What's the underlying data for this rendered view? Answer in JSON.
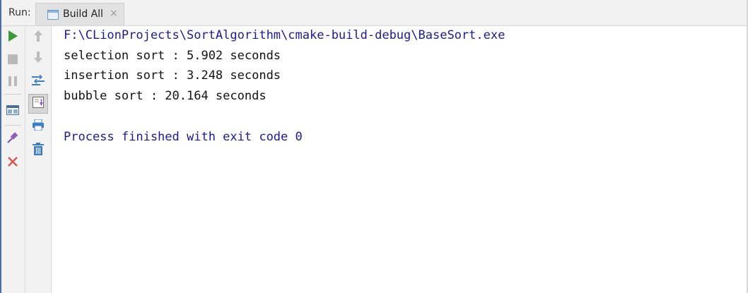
{
  "run_panel": {
    "run_label": "Run:",
    "tab": {
      "label": "Build All",
      "close": "×"
    }
  },
  "toolbar_left": [
    {
      "name": "rerun-button",
      "icon": "play-icon"
    },
    {
      "name": "stop-button",
      "icon": "stop-icon"
    },
    {
      "name": "pause-button",
      "icon": "pause-icon"
    },
    {
      "name": "layout-button",
      "icon": "layout-icon"
    },
    {
      "name": "pin-button",
      "icon": "pin-icon"
    },
    {
      "name": "close-button",
      "icon": "close-icon"
    }
  ],
  "toolbar_right": [
    {
      "name": "up-button",
      "icon": "arrow-up-icon"
    },
    {
      "name": "down-button",
      "icon": "arrow-down-icon"
    },
    {
      "name": "soft-wrap-button",
      "icon": "soft-wrap-icon"
    },
    {
      "name": "scroll-to-end-button",
      "icon": "scroll-to-end-icon"
    },
    {
      "name": "print-button",
      "icon": "print-icon"
    },
    {
      "name": "clear-all-button",
      "icon": "trash-icon"
    }
  ],
  "console": {
    "command": "F:\\CLionProjects\\SortAlgorithm\\cmake-build-debug\\BaseSort.exe",
    "output": [
      "selection sort : 5.902 seconds",
      "insertion sort : 3.248 seconds",
      "bubble sort : 20.164 seconds"
    ],
    "exit_message": "Process finished with exit code 0"
  },
  "colors": {
    "command_text": "#1b1b8f",
    "output_text": "#111111",
    "play_green": "#3c9a3c",
    "close_red": "#d9534f",
    "accent_blue": "#3d7fc1"
  }
}
